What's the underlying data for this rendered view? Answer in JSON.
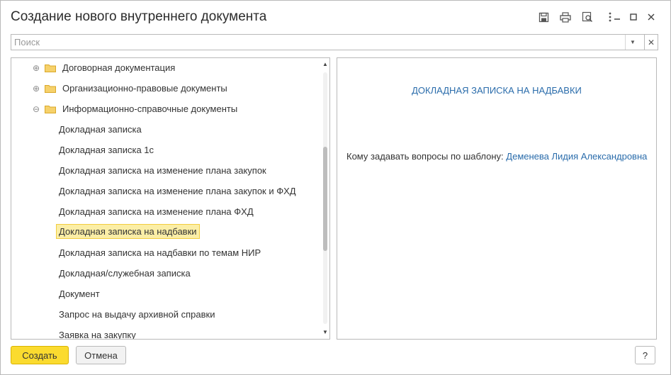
{
  "window": {
    "title": "Создание нового внутреннего документа"
  },
  "header_icons": [
    {
      "name": "save-icon",
      "glyph": "💾"
    },
    {
      "name": "print-icon",
      "glyph": "⎙"
    },
    {
      "name": "preview-icon",
      "glyph": "🔍"
    },
    {
      "name": "more-icon",
      "glyph": "⋮"
    },
    {
      "name": "minimize-icon",
      "glyph": "–"
    },
    {
      "name": "maximize-icon",
      "glyph": "☐"
    },
    {
      "name": "close-icon",
      "glyph": "✕"
    }
  ],
  "search": {
    "placeholder": "Поиск",
    "value": "",
    "dropdown_glyph": "▼",
    "clear_glyph": "✕"
  },
  "tree": {
    "groups": [
      {
        "label": "Договорная документация",
        "expander": "⊕"
      },
      {
        "label": "Организационно-правовые документы",
        "expander": "⊕"
      },
      {
        "label": "Информационно-справочные документы",
        "expander": "⊖"
      }
    ],
    "items": [
      "Докладная записка",
      "Докладная записка 1с",
      "Докладная записка на изменение плана закупок",
      "Докладная записка на изменение плана закупок и ФХД",
      "Докладная записка на изменение плана ФХД",
      "Докладная записка на надбавки",
      "Докладная записка на надбавки по темам НИР",
      "Докладная/служебная записка",
      "Документ",
      "Запрос на выдачу архивной справки",
      "Заявка на закупку"
    ],
    "selected_index": 5,
    "scroll_up_glyph": "▲",
    "scroll_down_glyph": "▼"
  },
  "preview": {
    "template_title": "ДОКЛАДНАЯ ЗАПИСКА НА НАДБАВКИ",
    "questions_label": "Кому задавать вопросы по шаблону:",
    "contact_name": "Деменева Лидия Александровна"
  },
  "footer": {
    "create_label": "Создать",
    "cancel_label": "Отмена",
    "help_label": "?"
  },
  "colors": {
    "accent_link": "#2a6cab",
    "primary_button": "#fbdb2f",
    "selection_fill": "#fbeea6",
    "selection_border": "#f2cd3f",
    "folder": "#f2c045"
  }
}
